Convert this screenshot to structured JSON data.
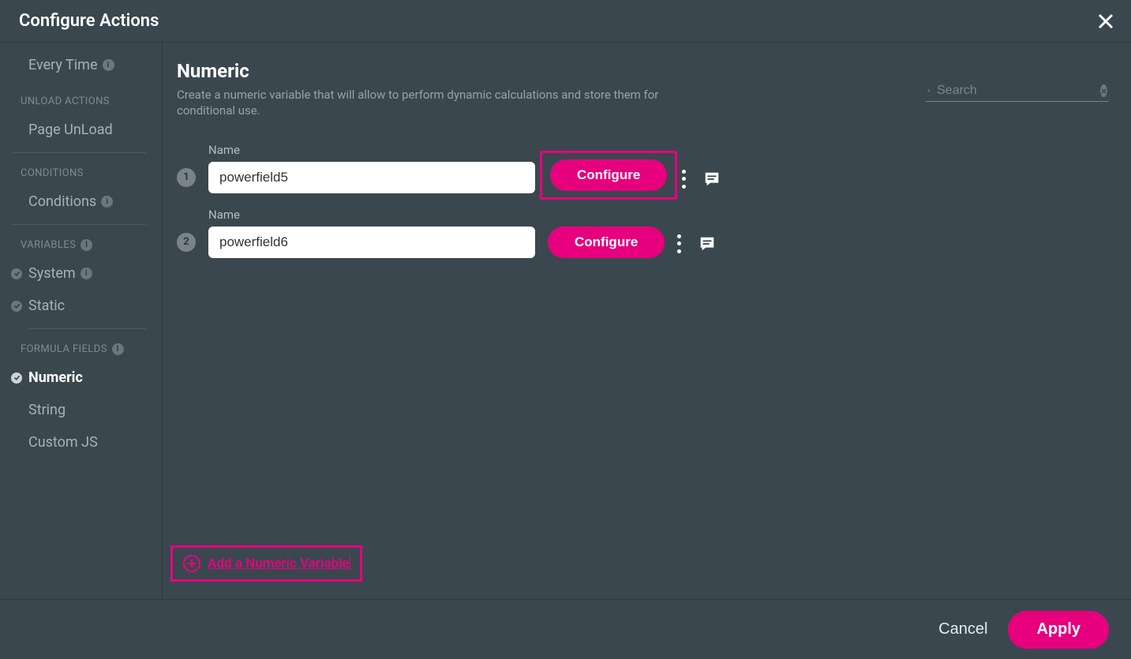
{
  "header": {
    "title": "Configure Actions"
  },
  "sidebar": {
    "items": [
      {
        "kind": "item",
        "label": "Every Time",
        "info": true
      },
      {
        "kind": "heading",
        "label": "UNLOAD ACTIONS"
      },
      {
        "kind": "item",
        "label": "Page UnLoad"
      },
      {
        "kind": "divider"
      },
      {
        "kind": "heading",
        "label": "CONDITIONS"
      },
      {
        "kind": "item",
        "label": "Conditions",
        "info": true
      },
      {
        "kind": "divider"
      },
      {
        "kind": "heading",
        "label": "VARIABLES",
        "info": true
      },
      {
        "kind": "item",
        "label": "System",
        "check": true,
        "info": true
      },
      {
        "kind": "item",
        "label": "Static",
        "check": true
      },
      {
        "kind": "divider",
        "short": true
      },
      {
        "kind": "heading",
        "label": "FORMULA FIELDS",
        "info": true
      },
      {
        "kind": "item",
        "label": "Numeric",
        "check": true,
        "active": true
      },
      {
        "kind": "item",
        "label": "String"
      },
      {
        "kind": "item",
        "label": "Custom JS"
      }
    ]
  },
  "main": {
    "title": "Numeric",
    "description": "Create a numeric variable that will allow to perform dynamic calculations and store them for conditional use.",
    "search_placeholder": "Search",
    "rows": [
      {
        "step": "1",
        "name_label": "Name",
        "name_value": "powerfield5",
        "configure_label": "Configure",
        "highlighted": true
      },
      {
        "step": "2",
        "name_label": "Name",
        "name_value": "powerfield6",
        "configure_label": "Configure",
        "highlighted": false
      }
    ],
    "add_link_label": "Add a Numeric Variable"
  },
  "footer": {
    "cancel_label": "Cancel",
    "apply_label": "Apply"
  }
}
